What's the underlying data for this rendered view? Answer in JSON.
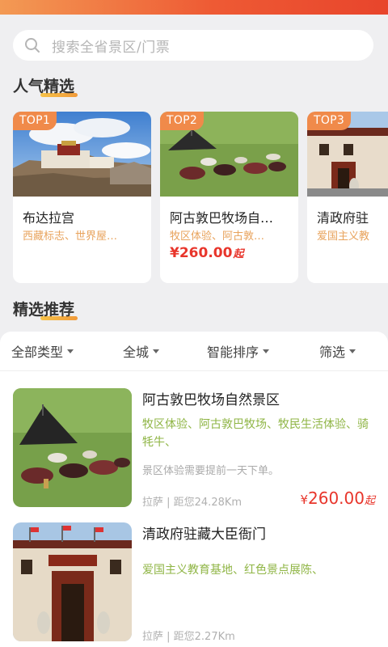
{
  "search": {
    "placeholder": "搜索全省景区/门票"
  },
  "sections": {
    "popular_title": "人气精选",
    "recommend_title": "精选推荐"
  },
  "popular": [
    {
      "badge": "TOP1",
      "name": "布达拉宫",
      "tags": "西藏标志、世界屋…",
      "price": ""
    },
    {
      "badge": "TOP2",
      "name": "阿古敦巴牧场自…",
      "tags": "牧区体验、阿古敦…",
      "price": "¥260.00",
      "price_suffix": "起"
    },
    {
      "badge": "TOP3",
      "name": "清政府驻",
      "tags": "爱国主义教",
      "price": ""
    }
  ],
  "filters": [
    "全部类型",
    "全城",
    "智能排序",
    "筛选"
  ],
  "list": [
    {
      "title": "阿古敦巴牧场自然景区",
      "tags": "牧区体验、阿古敦巴牧场、牧民生活体验、骑牦牛、",
      "notice": "景区体验需要提前一天下单。",
      "distance": "拉萨 | 距您24.28Km",
      "currency": "¥",
      "price": "260.00",
      "price_suffix": "起"
    },
    {
      "title": "清政府驻藏大臣衙门",
      "tags": "爱国主义教育基地、红色景点展陈、",
      "notice": "",
      "distance": "拉萨 | 距您2.27Km",
      "currency": "",
      "price": "",
      "price_suffix": ""
    }
  ],
  "colors": {
    "accent": "#e8352b",
    "tag_green": "#8fb545",
    "tag_orange": "#e8a35c",
    "badge": "#f08a4a"
  }
}
